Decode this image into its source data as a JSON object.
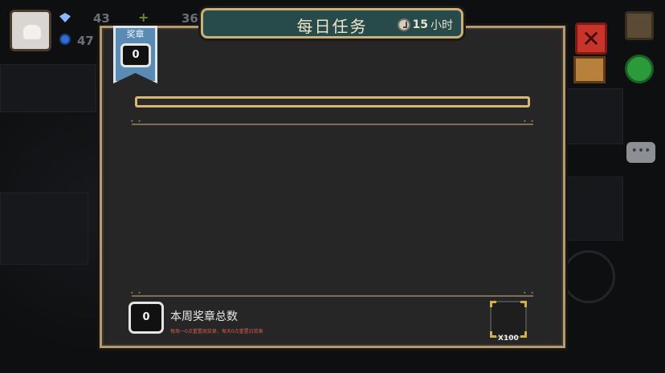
{
  "hud": {
    "gems": "43",
    "coins": "47",
    "resource": "36"
  },
  "title": "每日任务",
  "timer": {
    "value": "15",
    "unit": "小时"
  },
  "medal": {
    "label": "奖章",
    "count": "0"
  },
  "weekly": {
    "count": "0",
    "title": "本周奖章总数",
    "note": "每周一0点重置周奖章，每天0点重置日奖章"
  },
  "reward": {
    "multiplier": "X100"
  },
  "colors": {
    "title_bar": "#274a4b",
    "panel_bg": "#262626",
    "panel_border": "#b39b72",
    "progress_border": "#d7b873",
    "close_button": "#c73429",
    "medal_ribbon": "#5a8bb4"
  }
}
